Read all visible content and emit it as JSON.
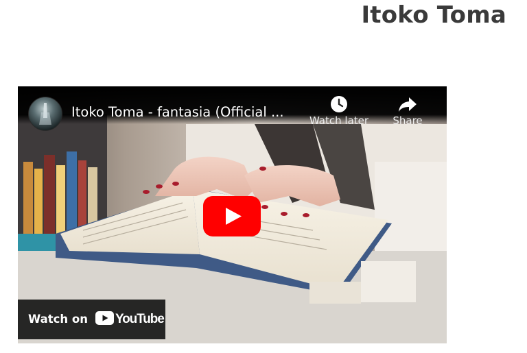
{
  "page": {
    "title": "Itoko Toma"
  },
  "video": {
    "title": "Itoko Toma - fantasia (Official ...",
    "watch_later_label": "Watch later",
    "share_label": "Share",
    "watch_on_label": "Watch on",
    "youtube_wordmark": "YouTube"
  },
  "icons": {
    "play": "play-icon",
    "watch_later": "clock-icon",
    "share": "share-arrow-icon",
    "youtube_logo": "youtube-logo-icon",
    "channel_avatar": "avatar"
  },
  "colors": {
    "play_button": "#ff0000",
    "player_background": "#000000",
    "title_text": "#3a3a3a"
  }
}
